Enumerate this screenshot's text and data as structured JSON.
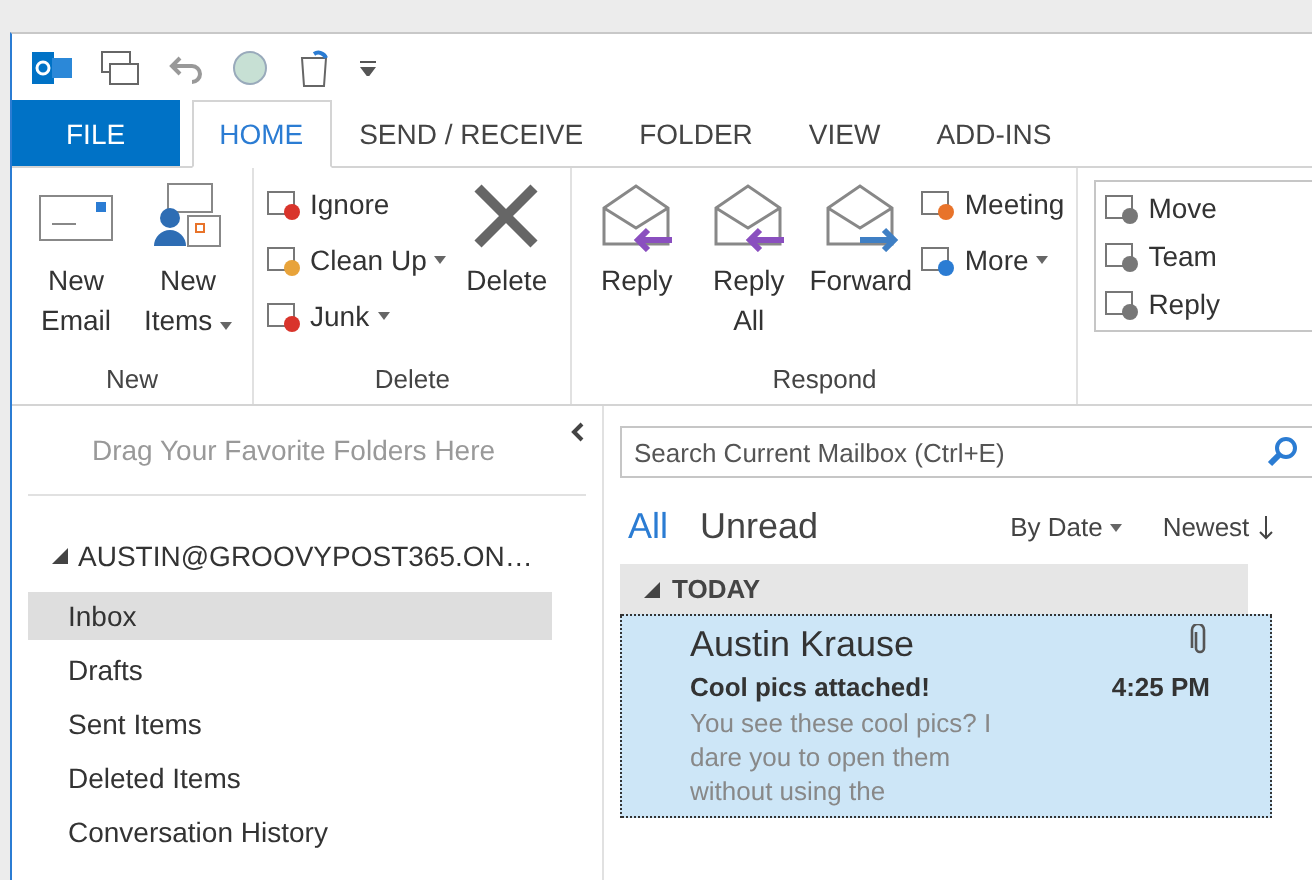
{
  "tabs": [
    {
      "label": "FILE",
      "kind": "file",
      "selected": false
    },
    {
      "label": "HOME",
      "kind": "tab",
      "selected": true
    },
    {
      "label": "SEND / RECEIVE",
      "kind": "tab",
      "selected": false
    },
    {
      "label": "FOLDER",
      "kind": "tab",
      "selected": false
    },
    {
      "label": "VIEW",
      "kind": "tab",
      "selected": false
    },
    {
      "label": "ADD-INS",
      "kind": "tab",
      "selected": false
    }
  ],
  "ribbon": {
    "groups": [
      {
        "label": "New",
        "items": [
          {
            "kind": "large",
            "label": "New Email",
            "dropdown": false
          },
          {
            "kind": "large",
            "label": "New Items",
            "dropdown": true
          }
        ]
      },
      {
        "label": "Delete",
        "items": [
          {
            "kind": "small",
            "label": "Ignore",
            "dropdown": false
          },
          {
            "kind": "small",
            "label": "Clean Up",
            "dropdown": true
          },
          {
            "kind": "small",
            "label": "Junk",
            "dropdown": true
          },
          {
            "kind": "large",
            "label": "Delete",
            "dropdown": false
          }
        ]
      },
      {
        "label": "Respond",
        "items": [
          {
            "kind": "large",
            "label": "Reply",
            "dropdown": false
          },
          {
            "kind": "large",
            "label": "Reply All",
            "dropdown": false
          },
          {
            "kind": "large",
            "label": "Forward",
            "dropdown": false
          },
          {
            "kind": "small",
            "label": "Meeting",
            "dropdown": false
          },
          {
            "kind": "small",
            "label": "More",
            "dropdown": true
          }
        ]
      }
    ],
    "quick_steps": [
      "Move",
      "Team",
      "Reply"
    ]
  },
  "folder_pane": {
    "favorites_hint": "Drag Your Favorite Folders Here",
    "account": {
      "label": "AUSTIN@GROOVYPOST365.ON…",
      "expanded": true,
      "children": [
        {
          "label": "Inbox",
          "selected": true
        },
        {
          "label": "Drafts",
          "selected": false
        },
        {
          "label": "Sent Items",
          "selected": false
        },
        {
          "label": "Deleted Items",
          "selected": false
        },
        {
          "label": "Conversation History",
          "selected": false
        }
      ]
    }
  },
  "mail_list": {
    "search": {
      "placeholder": "Search Current Mailbox (Ctrl+E)"
    },
    "filters": [
      {
        "label": "All",
        "selected": true
      },
      {
        "label": "Unread",
        "selected": false
      }
    ],
    "sort": {
      "by": "By Date",
      "order": "Newest"
    },
    "groups": [
      {
        "label": "TODAY",
        "expanded": true,
        "messages": [
          {
            "sender": "Austin Krause",
            "subject": "Cool pics attached!",
            "time": "4:25 PM",
            "preview": "You see these cool pics? I dare you to open them without using the",
            "attachment": true,
            "selected": true
          }
        ]
      }
    ]
  }
}
